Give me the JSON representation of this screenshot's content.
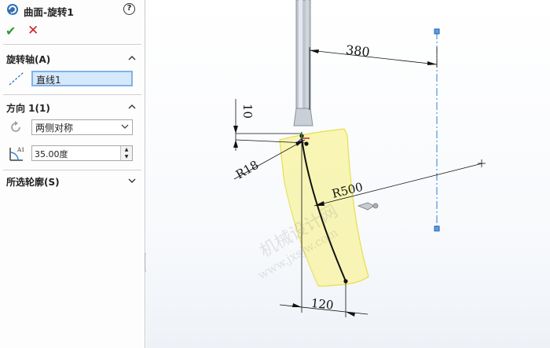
{
  "panel": {
    "title": "曲面-旋转1",
    "help_glyph": "?",
    "ok_glyph": "✔",
    "cancel_glyph": "✕",
    "sections": {
      "axis": {
        "title": "旋转轴(A)",
        "value": "直线1"
      },
      "direction": {
        "title": "方向 1(1)",
        "type_value": "两侧对称",
        "angle_value": "35.00度",
        "angle_icon_label": "A1"
      },
      "contours": {
        "title": "所选轮廓(S)"
      }
    }
  },
  "viewport": {
    "dimensions": {
      "d380": "380",
      "d10": "10",
      "r18": "R18",
      "r500": "R500",
      "d120": "120"
    },
    "watermark_line1": "机械设计网",
    "watermark_line2": "www.jxsjw.com"
  },
  "colors": {
    "surface_fill": "#f7f3a8",
    "surface_edge": "#e7de4e",
    "axis_line": "#2f7fd0",
    "ok_green": "#2e9a2e",
    "cancel_red": "#d42020",
    "field_highlight": "#d6e8fb"
  }
}
